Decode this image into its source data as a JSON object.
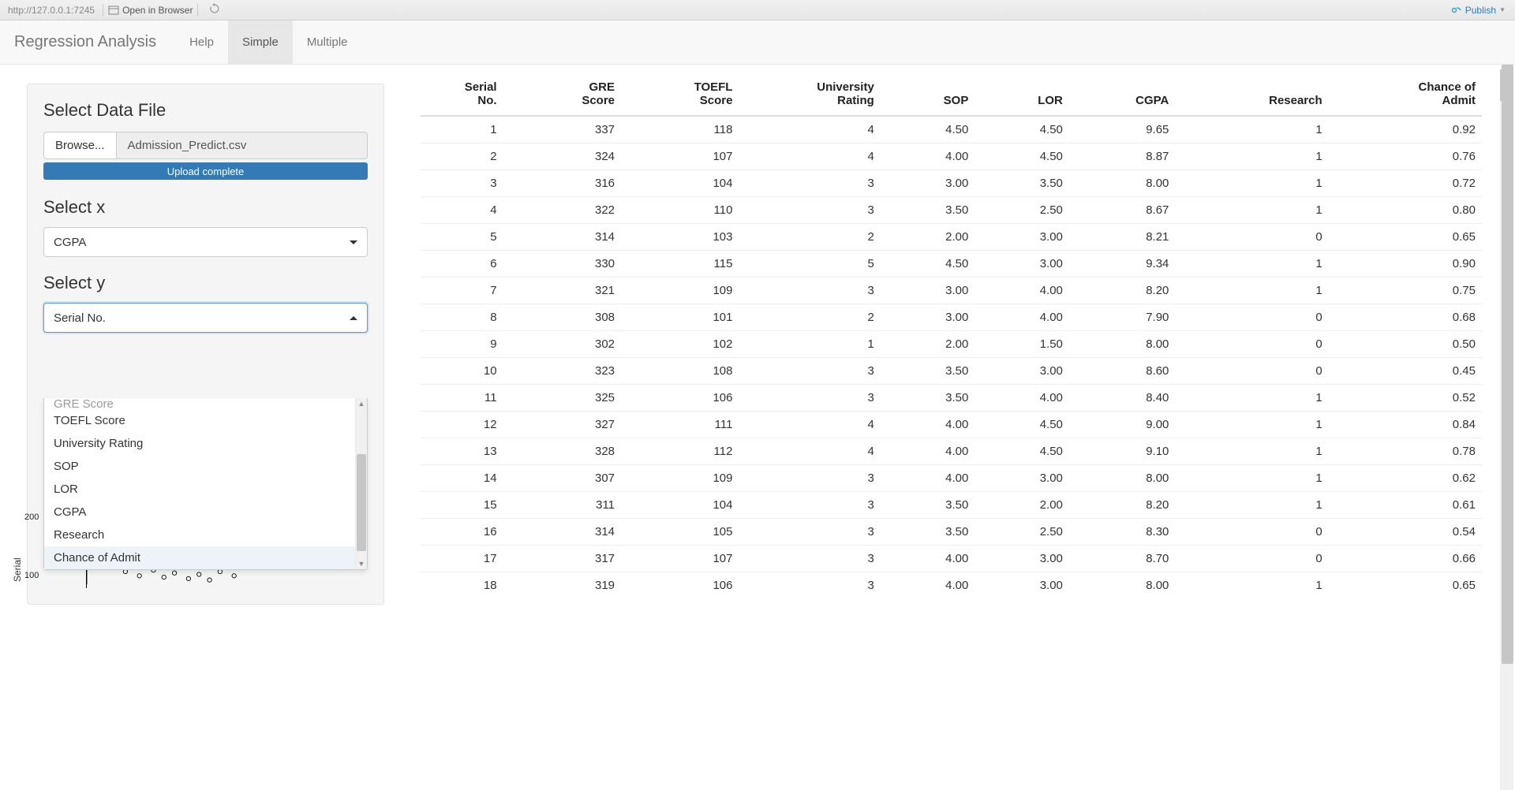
{
  "toolbar": {
    "url": "http://127.0.0.1:7245",
    "open_browser": "Open in Browser",
    "publish": "Publish"
  },
  "nav": {
    "brand": "Regression Analysis",
    "items": [
      "Help",
      "Simple",
      "Multiple"
    ],
    "active_index": 1
  },
  "sidebar": {
    "file_label": "Select Data File",
    "browse_label": "Browse...",
    "filename": "Admission_Predict.csv",
    "progress_text": "Upload complete",
    "select_x": {
      "label": "Select x",
      "value": "CGPA"
    },
    "select_y": {
      "label": "Select y",
      "value": "Serial No.",
      "truncated_top": "GRE Score",
      "options": [
        "TOEFL Score",
        "University Rating",
        "SOP",
        "LOR",
        "CGPA",
        "Research",
        "Chance of Admit"
      ],
      "highlight_index": 6
    },
    "plot_ylabel": "Serial",
    "plot_ticks": [
      "200",
      "100"
    ]
  },
  "table": {
    "headers": [
      "Serial No.",
      "GRE Score",
      "TOEFL Score",
      "University Rating",
      "SOP",
      "LOR",
      "CGPA",
      "Research",
      "Chance of Admit"
    ],
    "rows": [
      [
        1,
        337,
        118,
        4,
        "4.50",
        "4.50",
        "9.65",
        1,
        "0.92"
      ],
      [
        2,
        324,
        107,
        4,
        "4.00",
        "4.50",
        "8.87",
        1,
        "0.76"
      ],
      [
        3,
        316,
        104,
        3,
        "3.00",
        "3.50",
        "8.00",
        1,
        "0.72"
      ],
      [
        4,
        322,
        110,
        3,
        "3.50",
        "2.50",
        "8.67",
        1,
        "0.80"
      ],
      [
        5,
        314,
        103,
        2,
        "2.00",
        "3.00",
        "8.21",
        0,
        "0.65"
      ],
      [
        6,
        330,
        115,
        5,
        "4.50",
        "3.00",
        "9.34",
        1,
        "0.90"
      ],
      [
        7,
        321,
        109,
        3,
        "3.00",
        "4.00",
        "8.20",
        1,
        "0.75"
      ],
      [
        8,
        308,
        101,
        2,
        "3.00",
        "4.00",
        "7.90",
        0,
        "0.68"
      ],
      [
        9,
        302,
        102,
        1,
        "2.00",
        "1.50",
        "8.00",
        0,
        "0.50"
      ],
      [
        10,
        323,
        108,
        3,
        "3.50",
        "3.00",
        "8.60",
        0,
        "0.45"
      ],
      [
        11,
        325,
        106,
        3,
        "3.50",
        "4.00",
        "8.40",
        1,
        "0.52"
      ],
      [
        12,
        327,
        111,
        4,
        "4.00",
        "4.50",
        "9.00",
        1,
        "0.84"
      ],
      [
        13,
        328,
        112,
        4,
        "4.00",
        "4.50",
        "9.10",
        1,
        "0.78"
      ],
      [
        14,
        307,
        109,
        3,
        "4.00",
        "3.00",
        "8.00",
        1,
        "0.62"
      ],
      [
        15,
        311,
        104,
        3,
        "3.50",
        "2.00",
        "8.20",
        1,
        "0.61"
      ],
      [
        16,
        314,
        105,
        3,
        "3.50",
        "2.50",
        "8.30",
        0,
        "0.54"
      ],
      [
        17,
        317,
        107,
        3,
        "4.00",
        "3.00",
        "8.70",
        0,
        "0.66"
      ],
      [
        18,
        319,
        106,
        3,
        "4.00",
        "3.00",
        "8.00",
        1,
        "0.65"
      ]
    ]
  }
}
